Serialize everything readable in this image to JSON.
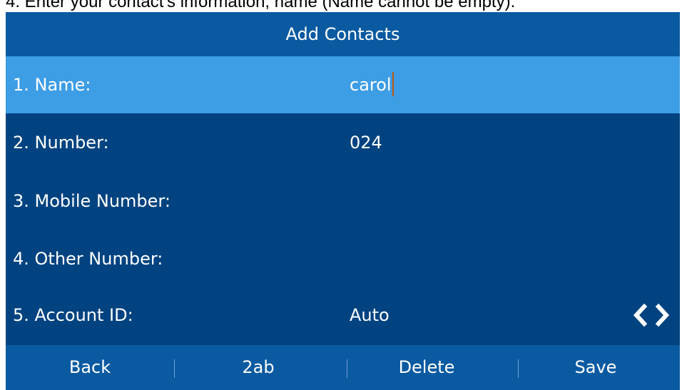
{
  "caption": "4. Enter your contact's information, name (Name cannot be empty).",
  "screen": {
    "title": "Add Contacts",
    "fields": [
      {
        "label": "1. Name:",
        "value": "carol",
        "selected": true,
        "editing": true
      },
      {
        "label": "2. Number:",
        "value": "024"
      },
      {
        "label": "3. Mobile Number:",
        "value": ""
      },
      {
        "label": "4. Other Number:",
        "value": ""
      },
      {
        "label": "5. Account ID:",
        "value": "Auto",
        "switch_icon": "left-right-arrows-icon"
      }
    ],
    "softkeys": [
      "Back",
      "2ab",
      "Delete",
      "Save"
    ]
  },
  "colors": {
    "background": "#004380",
    "bar": "#0a5aa1",
    "selected_row": "#3d9de5",
    "cursor": "#c05a10",
    "text": "#ffffff"
  }
}
